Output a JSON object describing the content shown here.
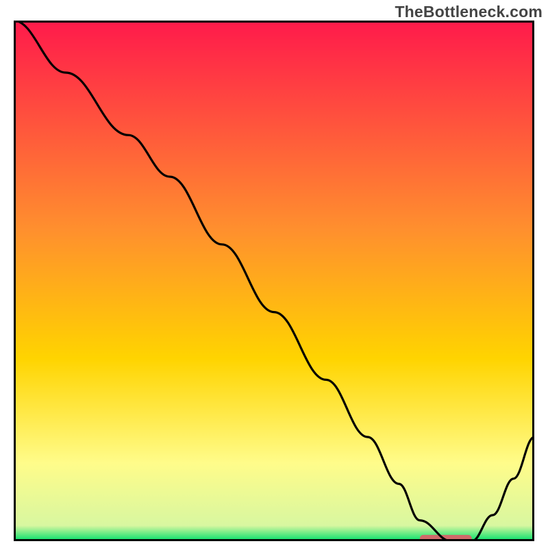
{
  "watermark": "TheBottleneck.com",
  "chart_data": {
    "type": "line",
    "title": "",
    "xlabel": "",
    "ylabel": "",
    "xlim": [
      0,
      100
    ],
    "ylim": [
      0,
      100
    ],
    "grid": false,
    "background_gradient": [
      {
        "y": 100,
        "color": "#ff1a4b"
      },
      {
        "y": 60,
        "color": "#ff8f2e"
      },
      {
        "y": 35,
        "color": "#ffd400"
      },
      {
        "y": 15,
        "color": "#fffc8a"
      },
      {
        "y": 3,
        "color": "#d8f7a0"
      },
      {
        "y": 0,
        "color": "#00e06a"
      }
    ],
    "series": [
      {
        "name": "curve",
        "color": "#000000",
        "x": [
          0,
          10,
          22,
          30,
          40,
          50,
          60,
          68,
          74,
          78,
          84,
          88,
          92,
          96,
          100
        ],
        "y": [
          100,
          90,
          78,
          70,
          57,
          44,
          31,
          20,
          11,
          4,
          0,
          0,
          5,
          12,
          20
        ]
      }
    ],
    "marker": {
      "name": "optimal-range",
      "color": "#d06a6a",
      "x_start": 78,
      "x_end": 88,
      "y": 0.5,
      "height": 1.4
    }
  }
}
